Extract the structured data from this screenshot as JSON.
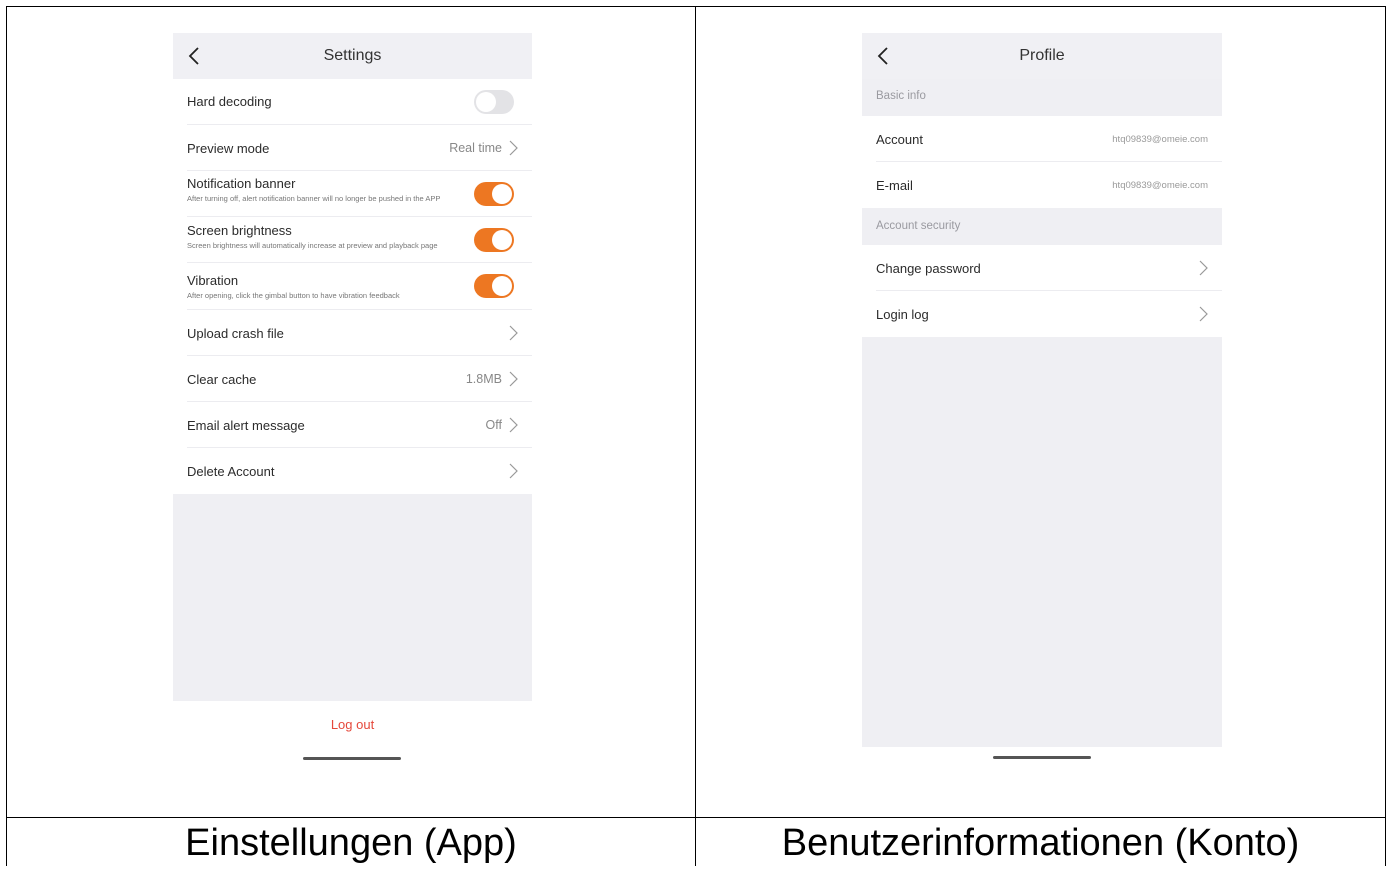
{
  "captions": {
    "left": "Einstellungen (App)",
    "right": "Benutzerinformationen (Konto)"
  },
  "settings": {
    "title": "Settings",
    "rows": {
      "hard_decoding": {
        "label": "Hard decoding",
        "enabled": false
      },
      "preview_mode": {
        "label": "Preview mode",
        "value": "Real time"
      },
      "notification_banner": {
        "label": "Notification banner",
        "description": "After turning off, alert notification banner will no longer be pushed in the APP",
        "enabled": true
      },
      "screen_brightness": {
        "label": "Screen brightness",
        "description": "Screen brightness will automatically increase at preview and playback page",
        "enabled": true
      },
      "vibration": {
        "label": "Vibration",
        "description": "After opening, click the gimbal button to have vibration feedback",
        "enabled": true
      },
      "upload_crash_file": {
        "label": "Upload crash file"
      },
      "clear_cache": {
        "label": "Clear cache",
        "value": "1.8MB"
      },
      "email_alert": {
        "label": "Email alert message",
        "value": "Off"
      },
      "delete_account": {
        "label": "Delete Account"
      }
    },
    "logout_label": "Log out"
  },
  "profile": {
    "title": "Profile",
    "basic_info_header": "Basic info",
    "account": {
      "label": "Account",
      "value": "htq09839@omeie.com"
    },
    "email": {
      "label": "E-mail",
      "value": "htq09839@omeie.com"
    },
    "security_header": "Account security",
    "change_password": {
      "label": "Change password"
    },
    "login_log": {
      "label": "Login log"
    }
  },
  "colors": {
    "toggle_on": "#ed7722",
    "toggle_off": "#e3e3e6",
    "logout_red": "#e5483b",
    "section_gray": "#efeff3"
  },
  "icons": [
    "back-icon",
    "chevron-right-icon"
  ]
}
